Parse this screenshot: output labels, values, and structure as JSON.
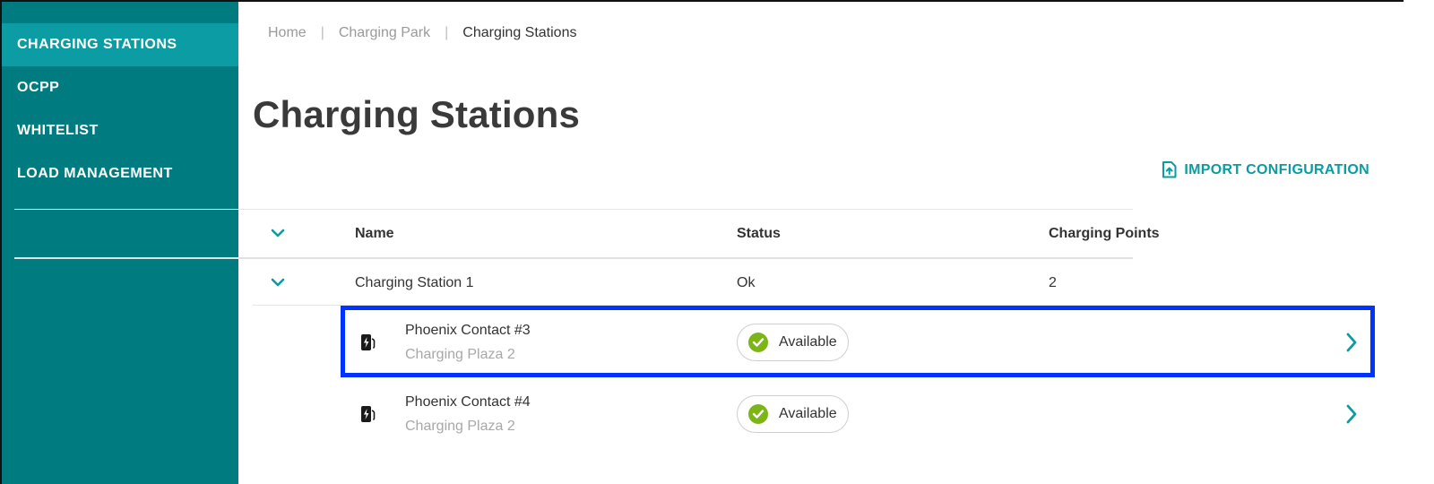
{
  "sidebar": {
    "items": [
      {
        "label": "CHARGING STATIONS"
      },
      {
        "label": "OCPP"
      },
      {
        "label": "WHITELIST"
      },
      {
        "label": "LOAD MANAGEMENT"
      }
    ]
  },
  "breadcrumb": {
    "items": [
      "Home",
      "Charging Park",
      "Charging Stations"
    ],
    "separator": "|"
  },
  "page": {
    "title": "Charging Stations",
    "import_label": "IMPORT CONFIGURATION"
  },
  "table": {
    "headers": {
      "name": "Name",
      "status": "Status",
      "points": "Charging Points"
    },
    "stations": [
      {
        "name": "Charging Station 1",
        "status": "Ok",
        "points": "2",
        "charging_points": [
          {
            "name": "Phoenix Contact #3",
            "location": "Charging Plaza 2",
            "status": "Available"
          },
          {
            "name": "Phoenix Contact #4",
            "location": "Charging Plaza 2",
            "status": "Available"
          }
        ]
      }
    ]
  },
  "colors": {
    "sidebar_bg": "#007c80",
    "sidebar_active": "#0b9da3",
    "accent": "#0a9ca0",
    "available_green": "#7cb518",
    "highlight": "#0033ff"
  }
}
